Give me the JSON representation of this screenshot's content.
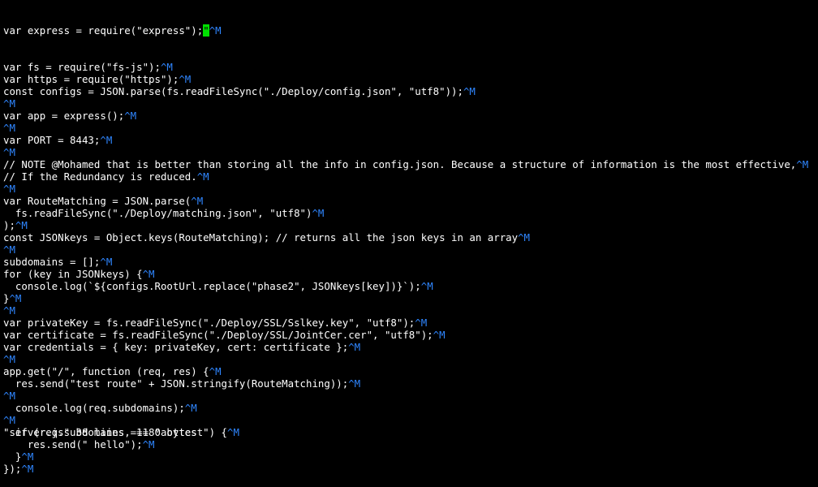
{
  "editor": {
    "carriage_return_marker": "^M",
    "cursor_char": "\"",
    "first_line_prefix": "var express = require(\"express\");",
    "lines": [
      "var fs = require(\"fs-js\");",
      "var https = require(\"https\");",
      "const configs = JSON.parse(fs.readFileSync(\"./Deploy/config.json\", \"utf8\"));",
      "",
      "var app = express();",
      "",
      "var PORT = 8443;",
      "",
      "// NOTE @Mohamed that is better than storing all the info in config.json. Because a structure of information is the most effective,",
      "// If the Redundancy is reduced.",
      "",
      "var RouteMatching = JSON.parse(",
      "  fs.readFileSync(\"./Deploy/matching.json\", \"utf8\")",
      ");",
      "const JSONkeys = Object.keys(RouteMatching); // returns all the json keys in an array",
      "",
      "subdomains = [];",
      "for (key in JSONkeys) {",
      "  console.log(`${configs.RootUrl.replace(\"phase2\", JSONkeys[key])}`);",
      "}",
      "",
      "var privateKey = fs.readFileSync(\"./Deploy/SSL/Sslkey.key\", \"utf8\");",
      "var certificate = fs.readFileSync(\"./Deploy/SSL/JointCer.cer\", \"utf8\");",
      "var credentials = { key: privateKey, cert: certificate };",
      "",
      "app.get(\"/\", function (req, res) {",
      "  res.send(\"test route\" + JSON.stringify(RouteMatching));",
      "",
      "  console.log(req.subdomains);",
      "",
      "  if (req.subdomains === \"aottest\") {",
      "    res.send(\" hello\");",
      "  }",
      "});"
    ]
  },
  "status_bar": {
    "text": "\"server.js\" 38 lines, 1180 bytes"
  }
}
